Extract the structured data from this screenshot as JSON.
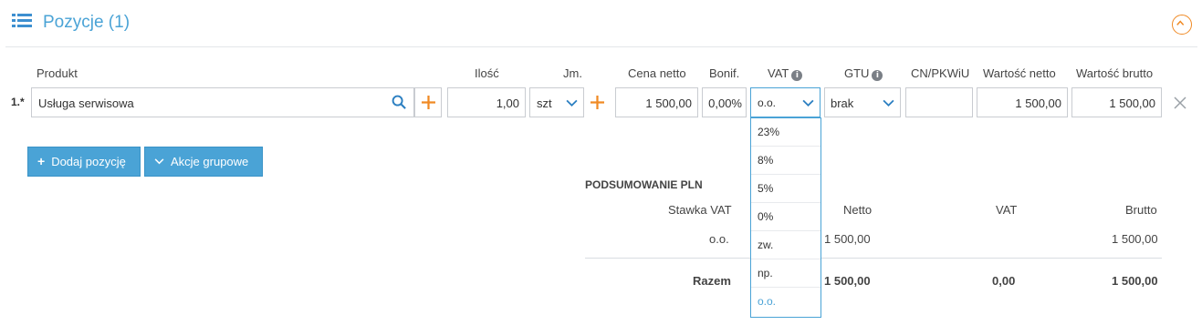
{
  "header": {
    "title": "Pozycje (1)",
    "list_icon": "list-icon",
    "collapse_icon": "chevron-up-circle-icon"
  },
  "columns": {
    "produkt": "Produkt",
    "ilosc": "Ilość",
    "jm": "Jm.",
    "cena_netto": "Cena netto",
    "bonif": "Bonif.",
    "vat": "VAT",
    "gtu": "GTU",
    "cn": "CN/PKWiU",
    "wartosc_netto": "Wartość netto",
    "wartosc_brutto": "Wartość brutto"
  },
  "row": {
    "number": "1.*",
    "product": "Usługa serwisowa",
    "quantity": "1,00",
    "unit": "szt",
    "net_price": "1 500,00",
    "discount": "0,00%",
    "vat": "o.o.",
    "gtu": "brak",
    "cn": "",
    "net_value": "1 500,00",
    "gross_value": "1 500,00"
  },
  "buttons": {
    "add_position": "Dodaj pozycję",
    "group_actions": "Akcje grupowe"
  },
  "vat_options": [
    "23%",
    "8%",
    "5%",
    "0%",
    "zw.",
    "np.",
    "o.o."
  ],
  "summary": {
    "title": "PODSUMOWANIE PLN",
    "headers": {
      "rate": "Stawka VAT",
      "net": "Netto",
      "vat": "VAT",
      "gross": "Brutto"
    },
    "rows": [
      {
        "rate": "o.o.",
        "net": "1 500,00",
        "vat": "",
        "gross": "1 500,00"
      }
    ],
    "total": {
      "label": "Razem",
      "net": "1 500,00",
      "vat": "0,00",
      "gross": "1 500,00"
    }
  },
  "colors": {
    "accent": "#4aa3d6",
    "orange": "#f08a24",
    "button": "#4aa3d6"
  }
}
